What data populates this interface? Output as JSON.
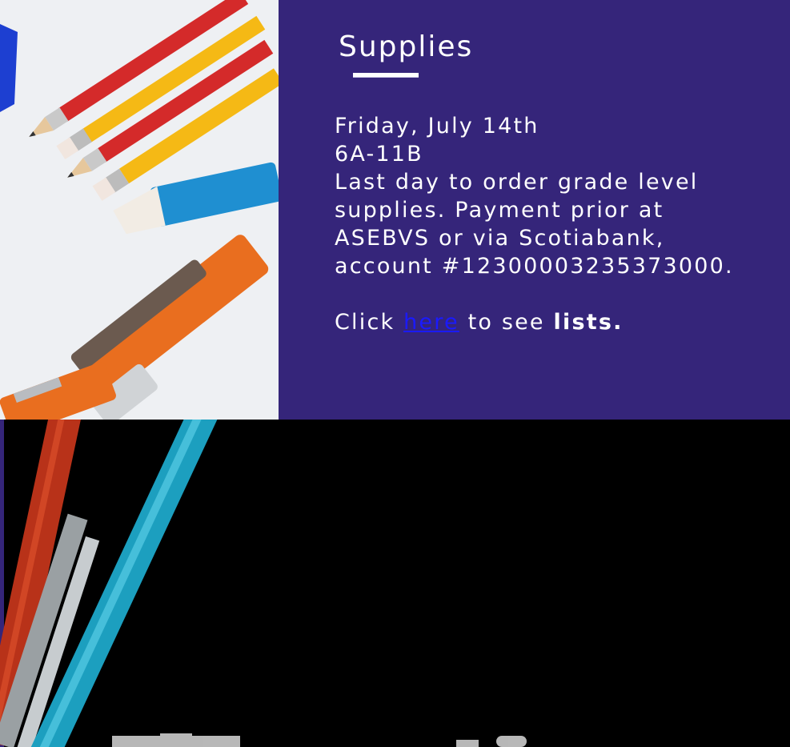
{
  "supplies_section": {
    "heading": "Supplies",
    "date": "Friday, July 14th",
    "time": "6A-11B",
    "description_lines": [
      "Last day to order grade level",
      "supplies.  Payment prior at",
      "ASEBVS or via Scotiabank,",
      "account #12300003235373000."
    ],
    "cta_prefix": "Click ",
    "cta_link": "here",
    "cta_middle": " to see ",
    "cta_bold": "lists."
  },
  "colors": {
    "panel_background": "#35257a",
    "link": "#1a1aff",
    "text": "#ffffff"
  }
}
